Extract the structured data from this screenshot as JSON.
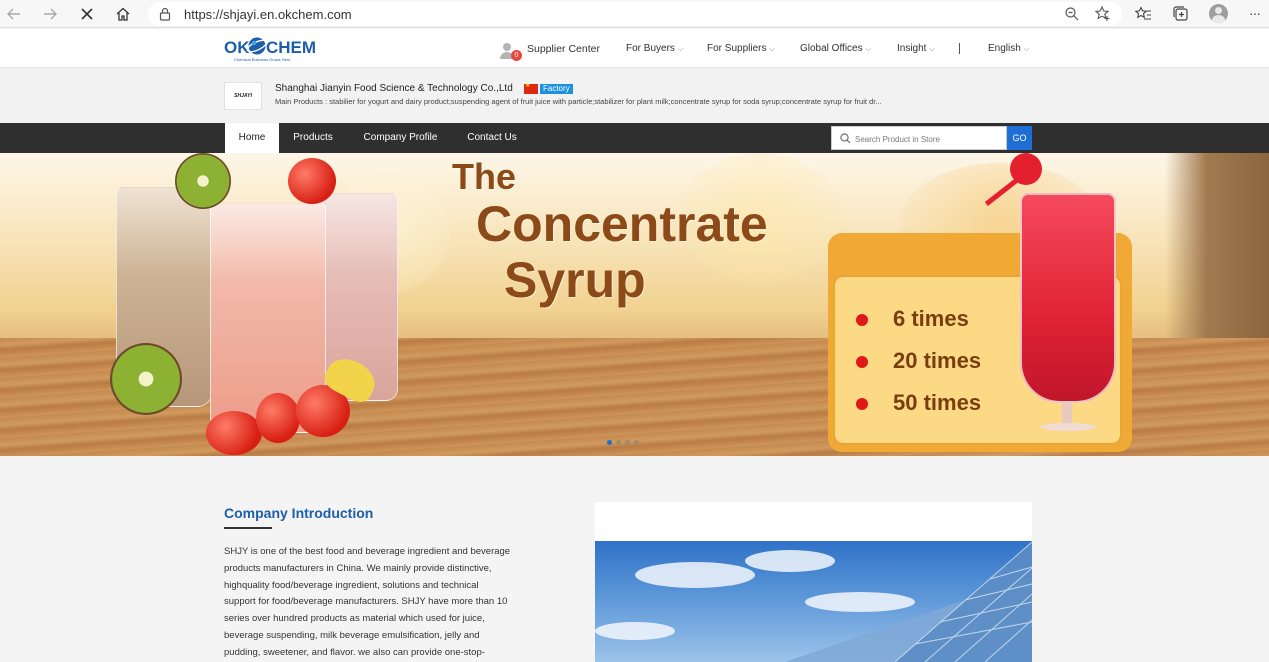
{
  "browser": {
    "url": "https://shjayi.en.okchem.com",
    "icons": [
      "back-icon",
      "forward-icon",
      "stop-icon",
      "home-icon",
      "lock-icon",
      "zoom-icon",
      "favorite-add-icon",
      "favorites-icon",
      "collections-icon",
      "profile-icon",
      "more-icon"
    ]
  },
  "site_header": {
    "logo_left": "OK",
    "logo_right": "CHEM",
    "logo_tagline": "Chemical Business Grows Here",
    "cart_count": "0",
    "supplier_center": "Supplier Center",
    "nav": [
      "For Buyers",
      "For Suppliers",
      "Global Offices",
      "Insight"
    ],
    "language": "English"
  },
  "store": {
    "logo_text": "SHJAYI",
    "name": "Shanghai Jianyin Food Science & Technology Co.,Ltd",
    "badge": "Factory",
    "main_products": "Main Products :  stabilier for yogurt and dairy product;suspending agent of fruit juice with particle;stabilizer for plant milk;concentrate syrup for soda syrup;concentrate syrup for fruit dr..."
  },
  "store_nav": {
    "items": [
      "Home",
      "Products",
      "Company Profile",
      "Contact Us"
    ],
    "active": "Home",
    "search_placeholder": "Search Product in Store",
    "go_label": "GO"
  },
  "banner": {
    "title_line1": "The",
    "title_line2": "Concentrate",
    "title_line3": "Syrup",
    "ratios": [
      "6 times",
      "20 times",
      "50 times"
    ],
    "slide_count": 4,
    "active_slide": 1,
    "colors": {
      "title": "#8b4a18",
      "card": "#f0a935",
      "bullet": "#e11818"
    }
  },
  "intro": {
    "title": "Company Introduction",
    "lines": [
      "SHJY is one of the best food and beverage ingredient and beverage",
      "products manufacturers in China. We mainly provide distinctive,",
      "highquality food/beverage ingredient, solutions and technical",
      "support for food/beverage manufacturers. SHJY have more than 10",
      "series over hundred products as material which used for juice,",
      "beverage suspending, milk beverage emulsification, jelly and",
      "pudding, sweetener, and flavor. we also can provide one-stop-"
    ]
  },
  "colors": {
    "brand_blue": "#1d5ea8",
    "go_blue": "#1d6fd6",
    "dark_nav": "#2f2f2f",
    "factory_badge": "#1e90e0"
  }
}
